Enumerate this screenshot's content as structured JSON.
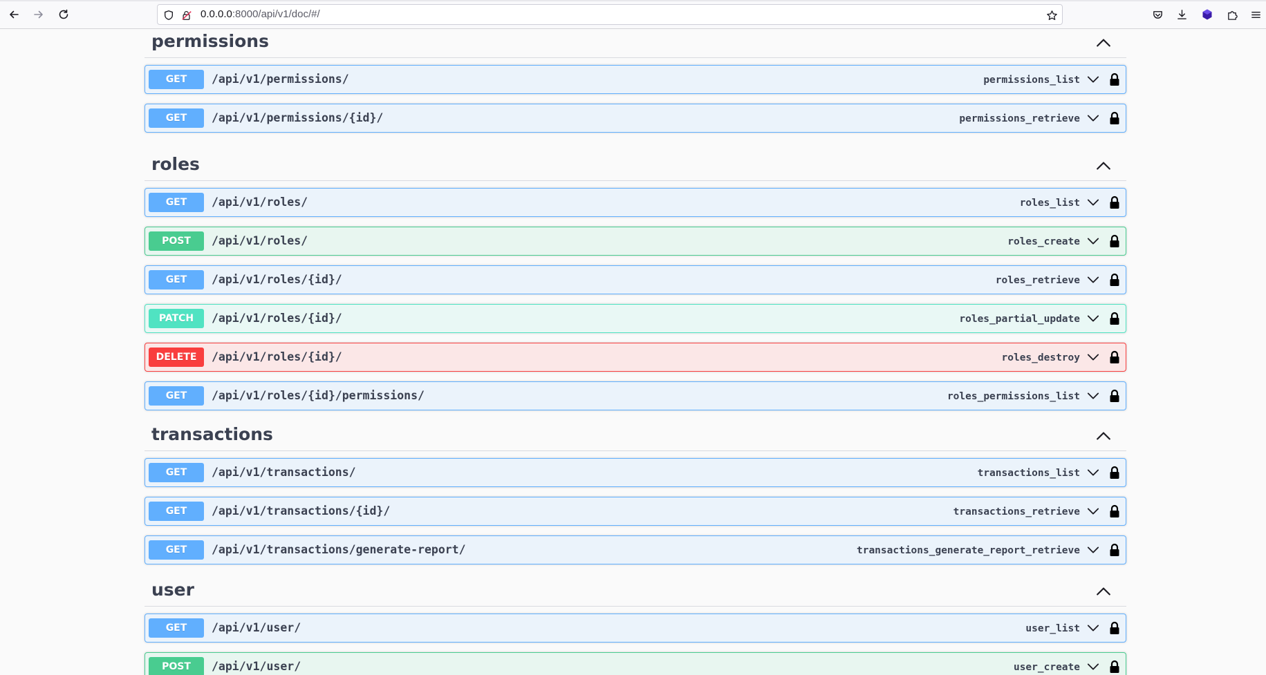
{
  "browser": {
    "url_host": "0.0.0.0",
    "url_rest": ":8000/api/v1/doc/#/"
  },
  "colors": {
    "get": "#61affe",
    "post": "#49cc90",
    "patch": "#50e3c2",
    "delete": "#f93e3e"
  },
  "tags": [
    {
      "name": "permissions",
      "operations": [
        {
          "method": "GET",
          "path": "/api/v1/permissions/",
          "operation_id": "permissions_list"
        },
        {
          "method": "GET",
          "path": "/api/v1/permissions/{id}/",
          "operation_id": "permissions_retrieve"
        }
      ]
    },
    {
      "name": "roles",
      "operations": [
        {
          "method": "GET",
          "path": "/api/v1/roles/",
          "operation_id": "roles_list"
        },
        {
          "method": "POST",
          "path": "/api/v1/roles/",
          "operation_id": "roles_create"
        },
        {
          "method": "GET",
          "path": "/api/v1/roles/{id}/",
          "operation_id": "roles_retrieve"
        },
        {
          "method": "PATCH",
          "path": "/api/v1/roles/{id}/",
          "operation_id": "roles_partial_update"
        },
        {
          "method": "DELETE",
          "path": "/api/v1/roles/{id}/",
          "operation_id": "roles_destroy"
        },
        {
          "method": "GET",
          "path": "/api/v1/roles/{id}/permissions/",
          "operation_id": "roles_permissions_list"
        }
      ]
    },
    {
      "name": "transactions",
      "operations": [
        {
          "method": "GET",
          "path": "/api/v1/transactions/",
          "operation_id": "transactions_list"
        },
        {
          "method": "GET",
          "path": "/api/v1/transactions/{id}/",
          "operation_id": "transactions_retrieve"
        },
        {
          "method": "GET",
          "path": "/api/v1/transactions/generate-report/",
          "operation_id": "transactions_generate_report_retrieve"
        }
      ]
    },
    {
      "name": "user",
      "operations": [
        {
          "method": "GET",
          "path": "/api/v1/user/",
          "operation_id": "user_list"
        },
        {
          "method": "POST",
          "path": "/api/v1/user/",
          "operation_id": "user_create"
        }
      ]
    }
  ]
}
